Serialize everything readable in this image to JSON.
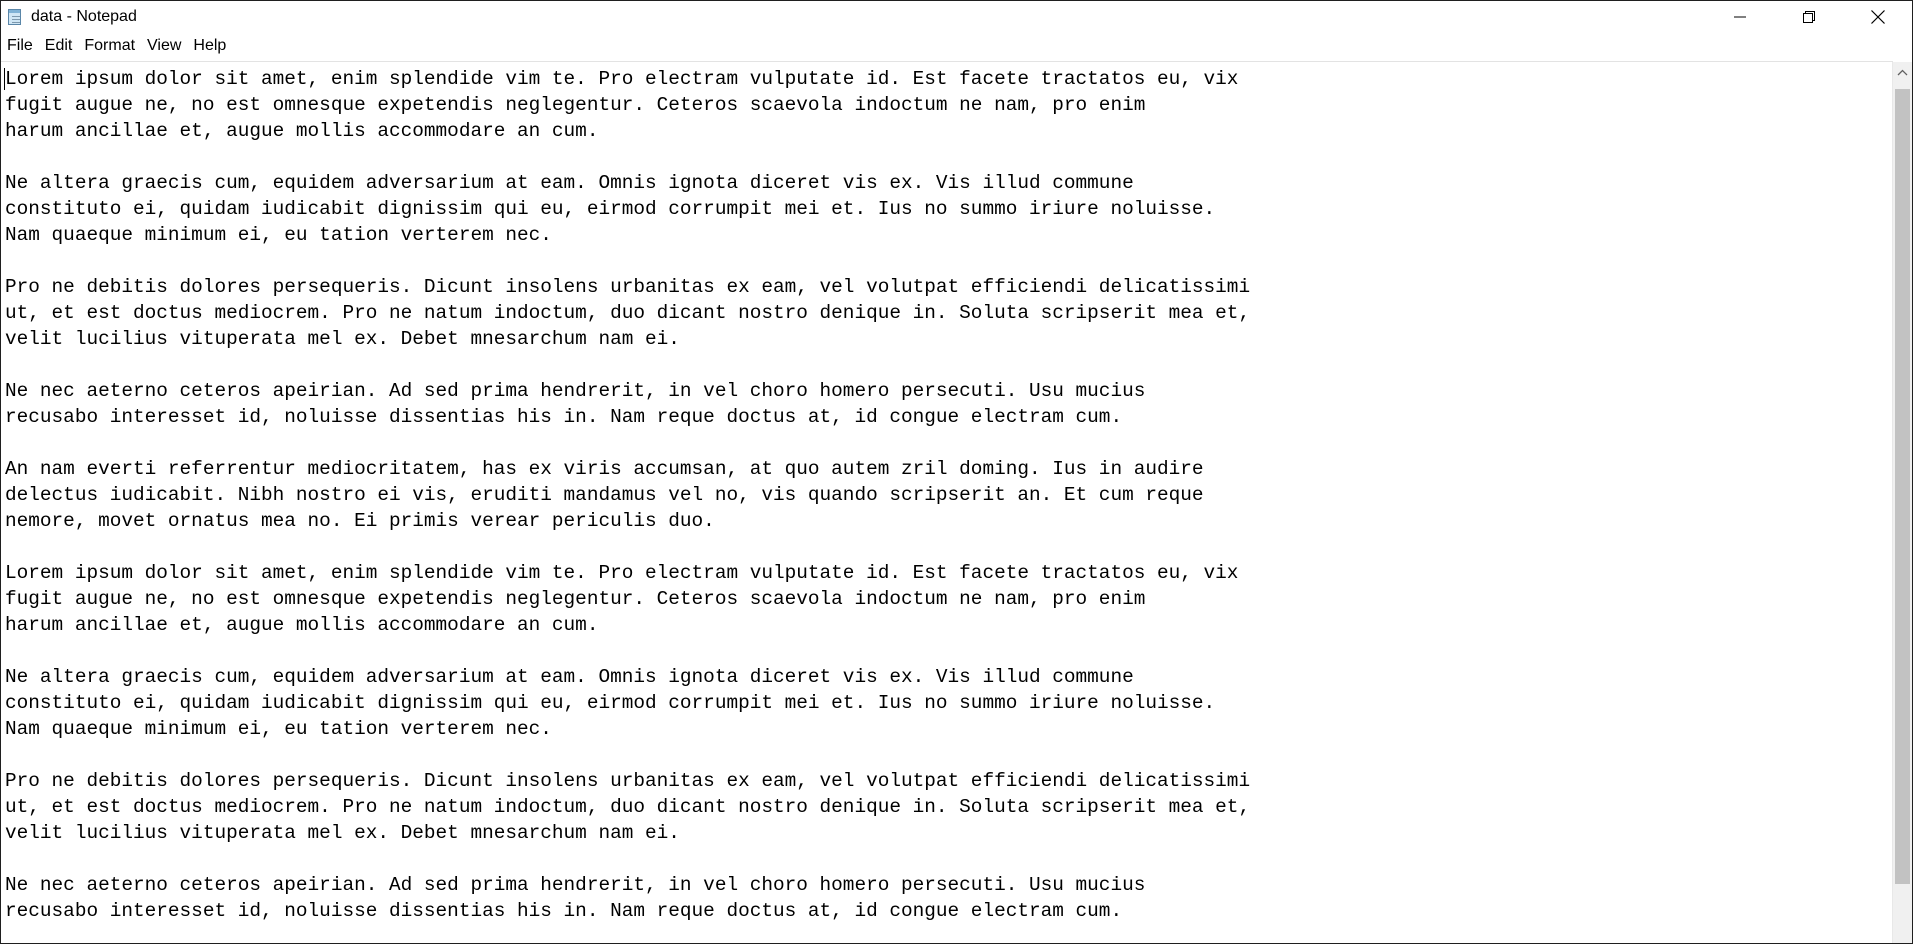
{
  "window": {
    "title": "data - Notepad"
  },
  "menu": [
    {
      "label": "File"
    },
    {
      "label": "Edit"
    },
    {
      "label": "Format"
    },
    {
      "label": "View"
    },
    {
      "label": "Help"
    }
  ],
  "document": {
    "text": "Lorem ipsum dolor sit amet, enim splendide vim te. Pro electram vulputate id. Est facete tractatos eu, vix\nfugit augue ne, no est omnesque expetendis neglegentur. Ceteros scaevola indoctum ne nam, pro enim\nharum ancillae et, augue mollis accommodare an cum.\n\nNe altera graecis cum, equidem adversarium at eam. Omnis ignota diceret vis ex. Vis illud commune\nconstituto ei, quidam iudicabit dignissim qui eu, eirmod corrumpit mei et. Ius no summo iriure noluisse.\nNam quaeque minimum ei, eu tation verterem nec.\n\nPro ne debitis dolores persequeris. Dicunt insolens urbanitas ex eam, vel volutpat efficiendi delicatissimi\nut, et est doctus mediocrem. Pro ne natum indoctum, duo dicant nostro denique in. Soluta scripserit mea et,\nvelit lucilius vituperata mel ex. Debet mnesarchum nam ei.\n\nNe nec aeterno ceteros apeirian. Ad sed prima hendrerit, in vel choro homero persecuti. Usu mucius\nrecusabo interesset id, noluisse dissentias his in. Nam reque doctus at, id congue electram cum.\n\nAn nam everti referrentur mediocritatem, has ex viris accumsan, at quo autem zril doming. Ius in audire\ndelectus iudicabit. Nibh nostro ei vis, eruditi mandamus vel no, vis quando scripserit an. Et cum reque\nnemore, movet ornatus mea no. Ei primis verear periculis duo.\n\nLorem ipsum dolor sit amet, enim splendide vim te. Pro electram vulputate id. Est facete tractatos eu, vix\nfugit augue ne, no est omnesque expetendis neglegentur. Ceteros scaevola indoctum ne nam, pro enim\nharum ancillae et, augue mollis accommodare an cum.\n\nNe altera graecis cum, equidem adversarium at eam. Omnis ignota diceret vis ex. Vis illud commune\nconstituto ei, quidam iudicabit dignissim qui eu, eirmod corrumpit mei et. Ius no summo iriure noluisse.\nNam quaeque minimum ei, eu tation verterem nec.\n\nPro ne debitis dolores persequeris. Dicunt insolens urbanitas ex eam, vel volutpat efficiendi delicatissimi\nut, et est doctus mediocrem. Pro ne natum indoctum, duo dicant nostro denique in. Soluta scripserit mea et,\nvelit lucilius vituperata mel ex. Debet mnesarchum nam ei.\n\nNe nec aeterno ceteros apeirian. Ad sed prima hendrerit, in vel choro homero persecuti. Usu mucius\nrecusabo interesset id, noluisse dissentias his in. Nam reque doctus at, id congue electram cum."
  },
  "icons": {
    "app": "notepad-icon",
    "minimize": "minimize-icon",
    "restore": "restore-icon",
    "close": "close-icon",
    "scroll_up": "chevron-up-icon"
  },
  "colors": {
    "background": "#ffffff",
    "text": "#000000",
    "scrollbar_track": "#f0f0f0",
    "scrollbar_thumb": "#c2c2c2"
  }
}
